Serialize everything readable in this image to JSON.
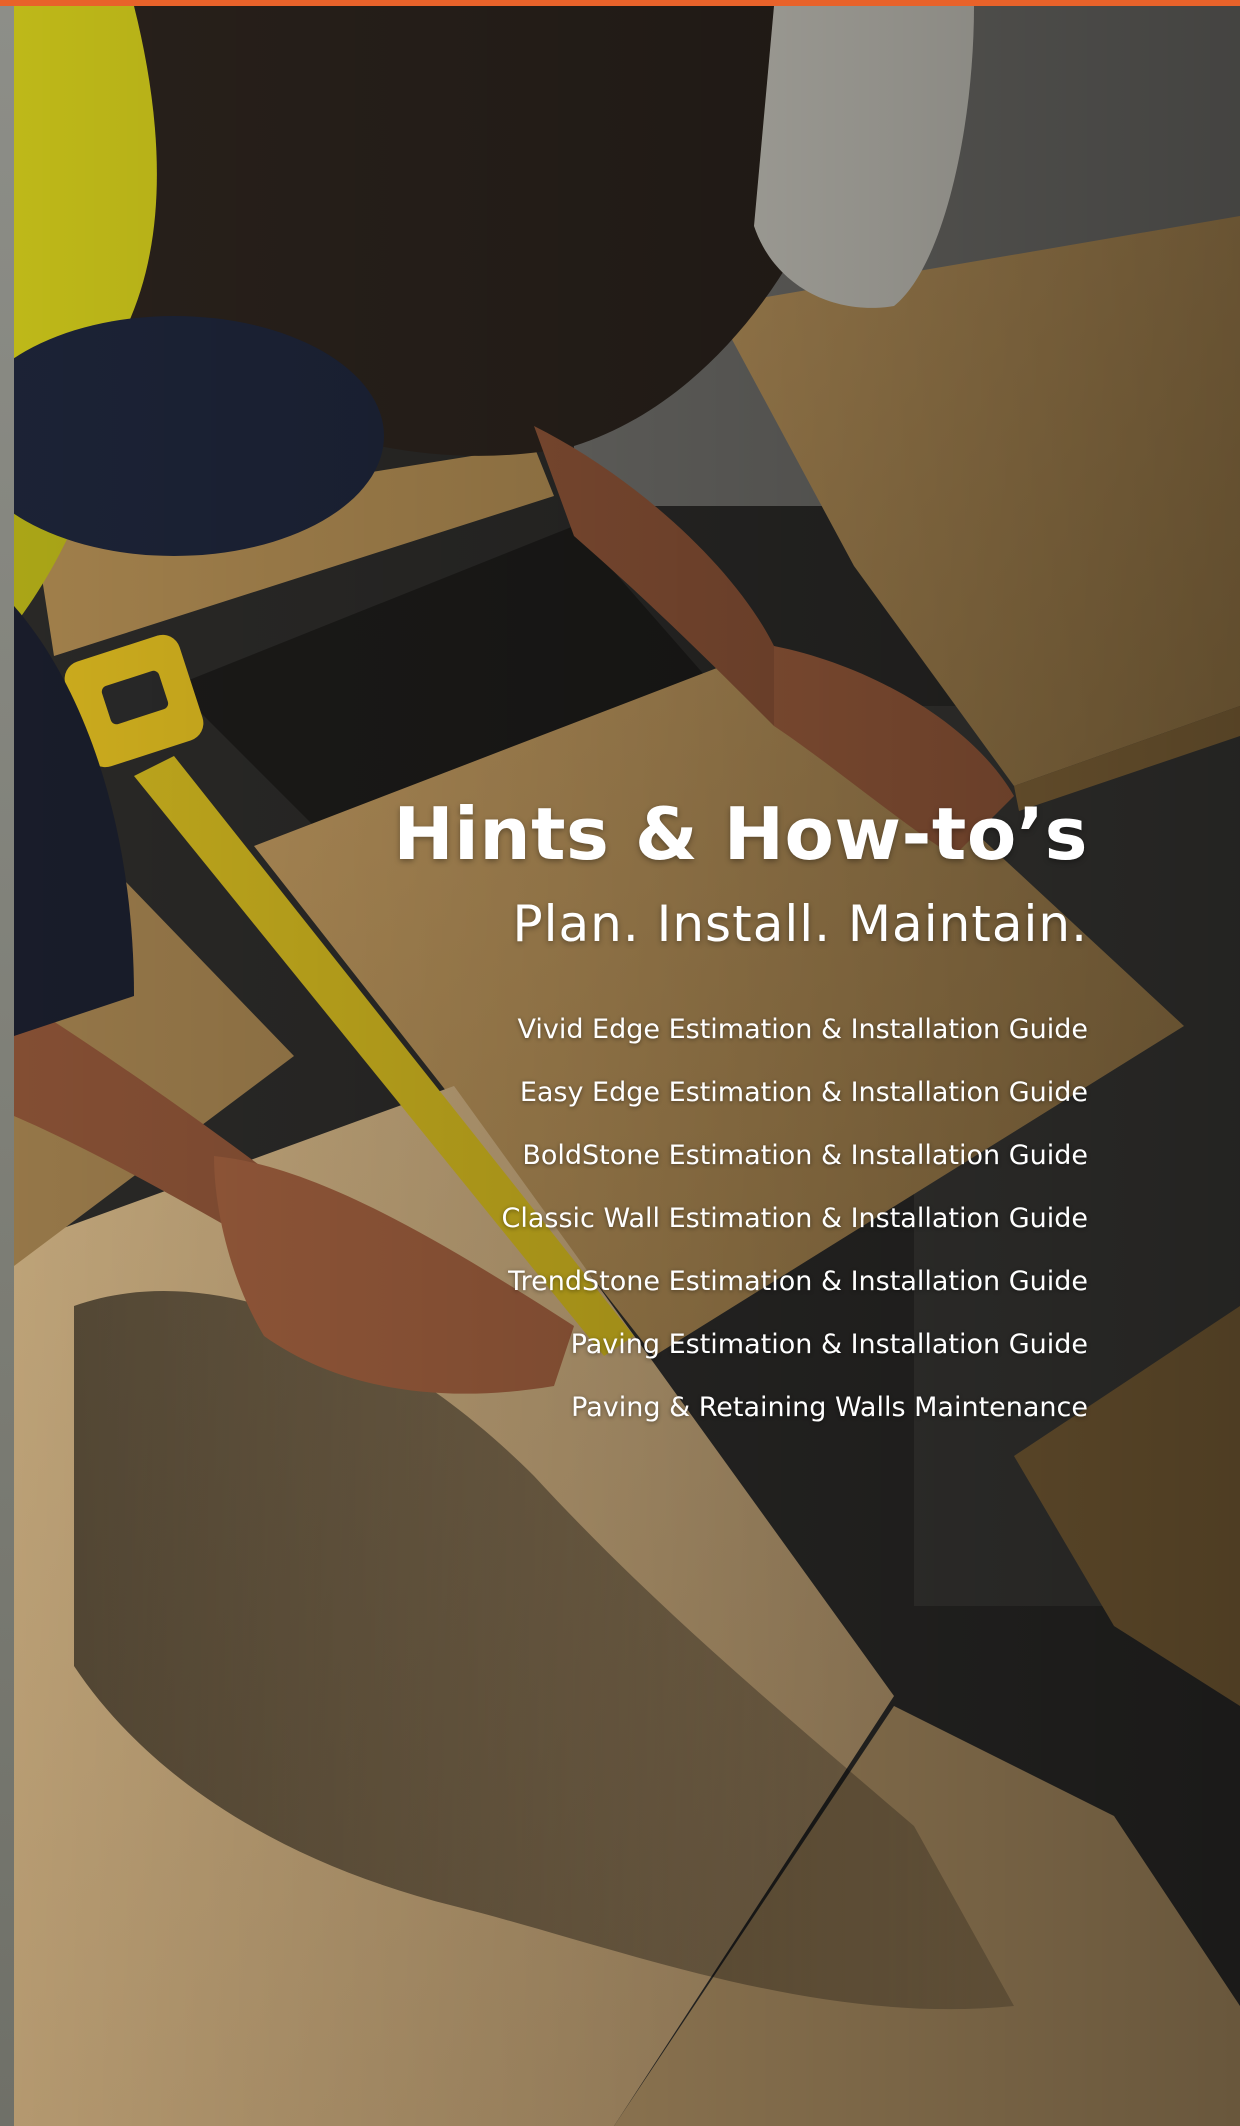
{
  "header": {
    "accent_color": "#e8622a"
  },
  "hero": {
    "image_description_icon": "tradesman-measuring-paving-photo",
    "title": "Hints & How-to’s",
    "subtitle": "Plan. Install. Maintain.",
    "guides": [
      {
        "label": "Vivid Edge Estimation & Installation Guide"
      },
      {
        "label": "Easy Edge Estimation & Installation Guide"
      },
      {
        "label": "BoldStone Estimation & Installation Guide"
      },
      {
        "label": "Classic Wall Estimation & Installation Guide"
      },
      {
        "label": "TrendStone Estimation & Installation Guide"
      },
      {
        "label": "Paving Estimation & Installation Guide"
      },
      {
        "label": "Paving & Retaining Walls Maintenance"
      }
    ]
  }
}
